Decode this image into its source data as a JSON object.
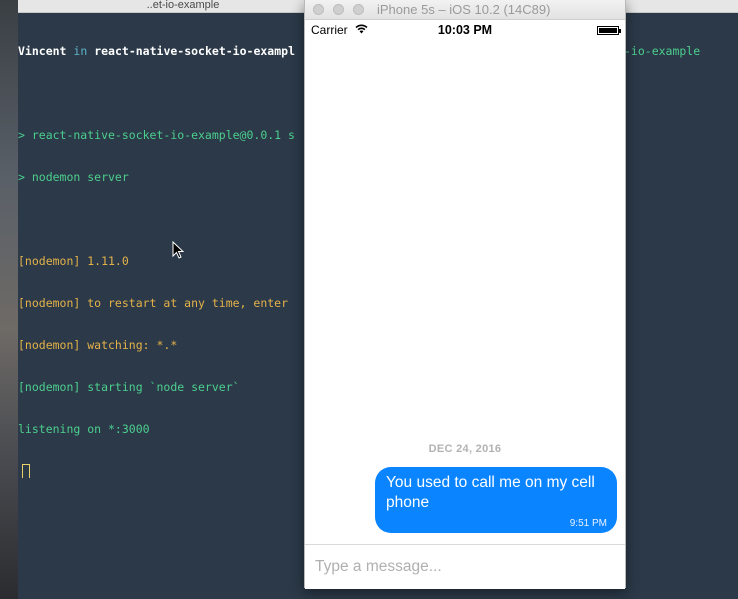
{
  "terminal": {
    "title": "..et-io-example",
    "prompt_user": "Vincent",
    "prompt_in": "in",
    "prompt_dir": "react-native-socket-io-exampl",
    "lines_green": [
      "> react-native-socket-io-example@0.0.1 s",
      "> nodemon server"
    ],
    "right_overflow_text": "-io-example",
    "lines_yellow": [
      "[nodemon] 1.11.0",
      "[nodemon] to restart at any time, enter",
      "[nodemon] watching: *.*"
    ],
    "lines_green_2": [
      "[nodemon] starting `node server`",
      "listening on *:3000"
    ]
  },
  "simulator": {
    "title": "iPhone 5s – iOS 10.2 (14C89)",
    "status_bar": {
      "carrier": "Carrier",
      "time": "10:03 PM"
    },
    "chat": {
      "date": "DEC 24, 2016",
      "messages": [
        {
          "text": "You used to call me on my cell phone",
          "time": "9:51 PM"
        }
      ]
    },
    "input": {
      "placeholder": "Type a message...",
      "value": ""
    }
  },
  "colors": {
    "bubble": "#0a84ff",
    "terminal_bg": "#2b3948",
    "terminal_green": "#4ccf8e",
    "terminal_yellow": "#e5b24a"
  }
}
